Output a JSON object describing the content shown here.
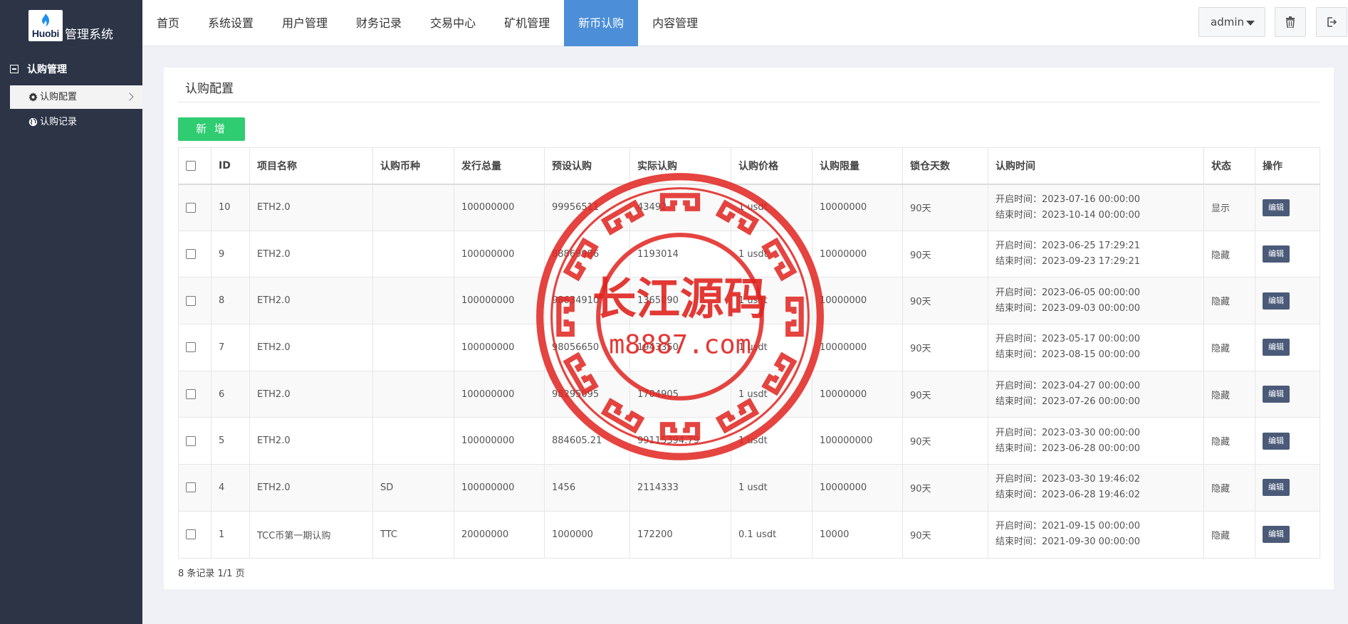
{
  "brand": {
    "logo_text": "Huobi",
    "title": "管理系统"
  },
  "nav": [
    {
      "label": "首页",
      "active": false
    },
    {
      "label": "系统设置",
      "active": false
    },
    {
      "label": "用户管理",
      "active": false
    },
    {
      "label": "财务记录",
      "active": false
    },
    {
      "label": "交易中心",
      "active": false
    },
    {
      "label": "矿机管理",
      "active": false
    },
    {
      "label": "新币认购",
      "active": true
    },
    {
      "label": "内容管理",
      "active": false
    }
  ],
  "header": {
    "user": "admin",
    "trash_icon": "trash-icon",
    "logout_icon": "logout-icon"
  },
  "sidebar": {
    "group": "认购管理",
    "items": [
      {
        "label": "认购配置",
        "icon": "gear-icon",
        "active": true
      },
      {
        "label": "认购记录",
        "icon": "globe-icon",
        "active": false
      }
    ]
  },
  "main": {
    "title": "认购配置",
    "add_label": "新 增",
    "columns": [
      "ID",
      "项目名称",
      "认购币种",
      "发行总量",
      "预设认购",
      "实际认购",
      "认购价格",
      "认购限量",
      "锁仓天数",
      "认购时间",
      "状态",
      "操作"
    ],
    "rows": [
      {
        "id": "10",
        "name": "ETH2.0",
        "coin": "",
        "total": "100000000",
        "preset": "99956511",
        "actual": "43492",
        "price": "1 usdt",
        "limit": "10000000",
        "lock": "90天",
        "start": "开启时间：2023-07-16 00:00:00",
        "end": "结束时间：2023-10-14 00:00:00",
        "status": "显示",
        "action": "编辑"
      },
      {
        "id": "9",
        "name": "ETH2.0",
        "coin": "",
        "total": "100000000",
        "preset": "88869986",
        "actual": "1193014",
        "price": "1 usdt",
        "limit": "10000000",
        "lock": "90天",
        "start": "开启时间：2023-06-25 17:29:21",
        "end": "结束时间：2023-09-23 17:29:21",
        "status": "隐藏",
        "action": "编辑"
      },
      {
        "id": "8",
        "name": "ETH2.0",
        "coin": "",
        "total": "100000000",
        "preset": "98634910",
        "actual": "1365090",
        "price": "1 usdt",
        "limit": "10000000",
        "lock": "90天",
        "start": "开启时间：2023-06-05 00:00:00",
        "end": "结束时间：2023-09-03 00:00:00",
        "status": "隐藏",
        "action": "编辑"
      },
      {
        "id": "7",
        "name": "ETH2.0",
        "coin": "",
        "total": "100000000",
        "preset": "98056650",
        "actual": "1943350",
        "price": "1 usdt",
        "limit": "10000000",
        "lock": "90天",
        "start": "开启时间：2023-05-17 00:00:00",
        "end": "结束时间：2023-08-15 00:00:00",
        "status": "隐藏",
        "action": "编辑"
      },
      {
        "id": "6",
        "name": "ETH2.0",
        "coin": "",
        "total": "100000000",
        "preset": "98295095",
        "actual": "1704905",
        "price": "1 usdt",
        "limit": "10000000",
        "lock": "90天",
        "start": "开启时间：2023-04-27 00:00:00",
        "end": "结束时间：2023-07-26 00:00:00",
        "status": "隐藏",
        "action": "编辑"
      },
      {
        "id": "5",
        "name": "ETH2.0",
        "coin": "",
        "total": "100000000",
        "preset": "884605.21",
        "actual": "99115394.79",
        "price": "1 usdt",
        "limit": "100000000",
        "lock": "90天",
        "start": "开启时间：2023-03-30 00:00:00",
        "end": "结束时间：2023-06-28 00:00:00",
        "status": "隐藏",
        "action": "编辑"
      },
      {
        "id": "4",
        "name": "ETH2.0",
        "coin": "SD",
        "total": "100000000",
        "preset": "1456",
        "actual": "2114333",
        "price": "1 usdt",
        "limit": "10000000",
        "lock": "90天",
        "start": "开启时间：2023-03-30 19:46:02",
        "end": "结束时间：2023-06-28 19:46:02",
        "status": "隐藏",
        "action": "编辑"
      },
      {
        "id": "1",
        "name": "TCC币第一期认购",
        "coin": "TTC",
        "total": "20000000",
        "preset": "1000000",
        "actual": "172200",
        "price": "0.1 usdt",
        "limit": "10000",
        "lock": "90天",
        "start": "开启时间：2021-09-15 00:00:00",
        "end": "结束时间：2021-09-30 00:00:00",
        "status": "隐藏",
        "action": "编辑"
      }
    ],
    "footer": "8 条记录 1/1 页"
  },
  "watermark": {
    "text_cn": "长江源码",
    "text_en": "m8887.com",
    "color": "#e0231f"
  }
}
